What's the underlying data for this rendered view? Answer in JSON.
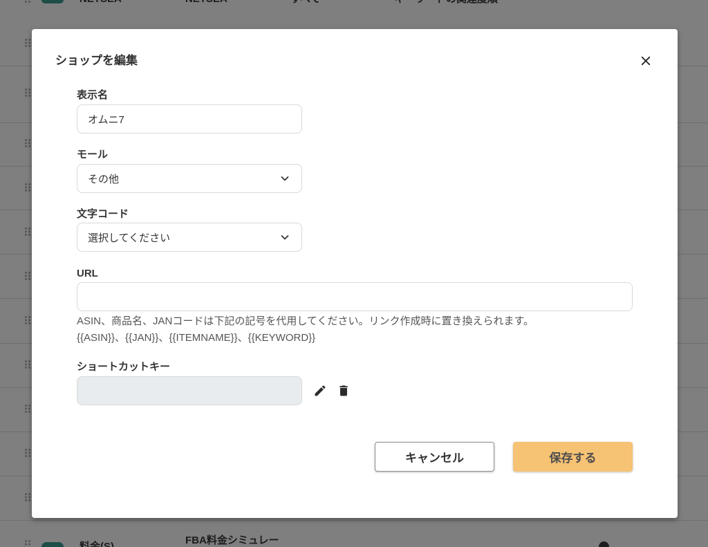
{
  "colors": {
    "overlay": "#7f7f7f",
    "toggle_on": "#1d4e48",
    "save_button": "#f6c274",
    "disabled_field": "#e9ecef"
  },
  "icons": {
    "close": "close-icon",
    "select_arrow": "chevron-down-icon",
    "edit": "pencil-icon",
    "delete": "trash-icon",
    "row_handle": "drag-handle-icon",
    "info": "info-icon"
  },
  "background_table": {
    "top_row": {
      "enabled": true,
      "display_name": "NETSEA",
      "mall": "NETSEA",
      "category": "すべて",
      "sort_order": "キーワードの関連度順"
    },
    "bottom_row": {
      "enabled": true,
      "display_name": "料金(S)",
      "mall": "FBA料金シミュレー"
    }
  },
  "modal": {
    "title": "ショップを編集",
    "display_name": {
      "label": "表示名",
      "value": "オムニ7"
    },
    "mall": {
      "label": "モール",
      "selected": "その他"
    },
    "charset": {
      "label": "文字コード",
      "selected": "選択してください"
    },
    "url": {
      "label": "URL",
      "value": "",
      "help": [
        "ASIN、商品名、JANコードは下記の記号を代用してください。リンク作成時に置き換えられます。",
        "{{ASIN}}、{{JAN}}、{{ITEMNAME}}、{{KEYWORD}}"
      ]
    },
    "shortcut_key": {
      "label": "ショートカットキー",
      "value": ""
    },
    "cancel_label": "キャンセル",
    "save_label": "保存する"
  }
}
